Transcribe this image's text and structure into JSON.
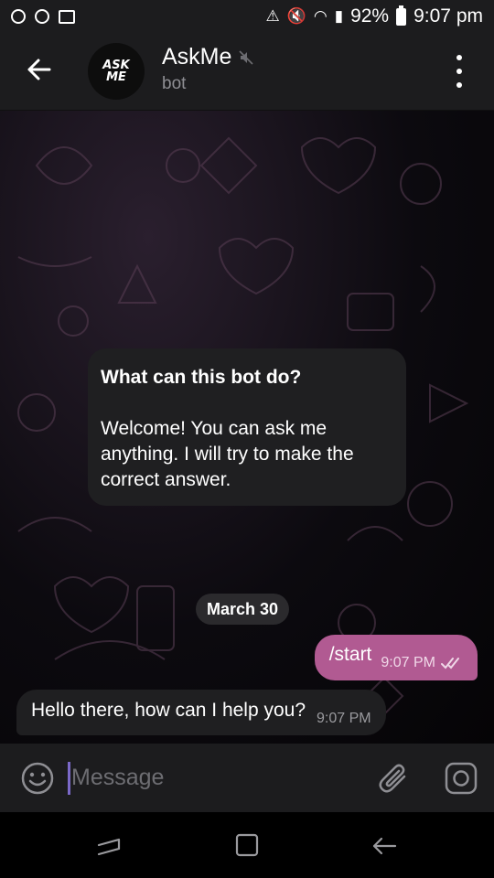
{
  "status_bar": {
    "icons": [
      "chat-notification-icon",
      "chat-notification-icon",
      "gallery-icon",
      "alert-icon",
      "mute-icon",
      "wifi-icon",
      "signal-icon"
    ],
    "battery": "92%",
    "time": "9:07 pm"
  },
  "header": {
    "avatar_text": [
      "ASK",
      "ME"
    ],
    "title": "AskMe",
    "subtitle": "bot"
  },
  "chat": {
    "intro": {
      "title": "What can this bot do?",
      "body": "Welcome! You can ask me anything. I will try to make the correct answer."
    },
    "date_chip": "March 30",
    "messages": [
      {
        "direction": "out",
        "text": "/start",
        "time": "9:07 PM",
        "status": "read"
      },
      {
        "direction": "in",
        "text": "Hello there, how can I help you?",
        "time": "9:07 PM"
      }
    ]
  },
  "input": {
    "placeholder": "Message"
  },
  "colors": {
    "accent": "#b15a92",
    "caret": "#7b69c9",
    "bubble_in": "#1f1f21",
    "bar_bg": "#1c1c1e"
  }
}
